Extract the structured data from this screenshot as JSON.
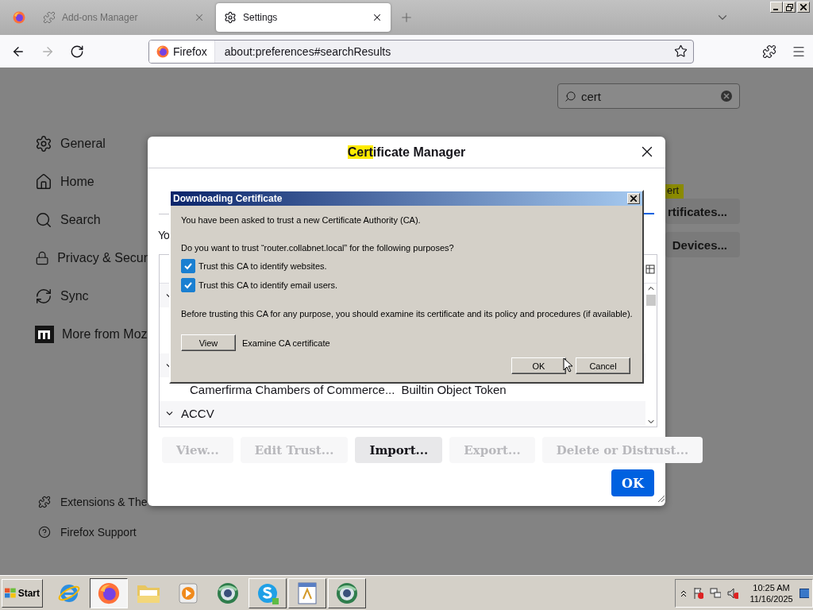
{
  "tab_strip": {
    "tabs": [
      {
        "label": "Add-ons Manager",
        "kind": "addons",
        "selected": false
      },
      {
        "label": "Settings",
        "kind": "settings",
        "selected": true
      }
    ]
  },
  "toolbar": {
    "buttons": [
      {
        "kind": "back",
        "disabled": false
      },
      {
        "kind": "forward",
        "disabled": true
      },
      {
        "kind": "reload",
        "disabled": false
      }
    ],
    "identity": "Firefox",
    "url": "about:preferences#searchResults"
  },
  "sidebar": {
    "items": [
      {
        "label": "General",
        "kind": "gear"
      },
      {
        "label": "Home",
        "kind": "home"
      },
      {
        "label": "Search",
        "kind": "search"
      },
      {
        "label": "Privacy & Secur",
        "kind": "lock"
      },
      {
        "label": "Sync",
        "kind": "sync"
      },
      {
        "label": "More from Moz",
        "kind": "mozilla"
      }
    ],
    "footer": [
      {
        "label": "Extensions & The",
        "kind": "puzzle"
      },
      {
        "label": "Firefox Support",
        "kind": "help"
      }
    ]
  },
  "search": {
    "value": "cert"
  },
  "results": [
    {
      "kind": "highlight",
      "text": "ert"
    },
    {
      "kind": "button",
      "text": "rtificates..."
    },
    {
      "kind": "button",
      "text": "Devices..."
    }
  ],
  "certificate_manager": {
    "title": [
      {
        "text": "Cert",
        "highlighted": true
      },
      {
        "text": "ificate Manager",
        "highlighted": false
      }
    ],
    "tab_fragment": "Yo",
    "rows": [
      {
        "kind": "group",
        "expanded": true
      },
      {
        "kind": "group",
        "expanded": true
      },
      {
        "kind": "cert",
        "name": "Camerfirma Chambers of Commerce...",
        "token": "Builtin Object Token"
      },
      {
        "kind": "group",
        "label": "ACCV",
        "expanded": true
      }
    ],
    "buttons": [
      {
        "label": "View...",
        "disabled": true
      },
      {
        "label": "Edit Trust...",
        "disabled": true
      },
      {
        "label": "Import...",
        "disabled": false
      },
      {
        "label": "Export...",
        "disabled": true
      },
      {
        "label": "Delete or Distrust...",
        "disabled": true
      }
    ],
    "ok_button": "OK"
  },
  "download_dialog": {
    "title": "Downloading Certificate",
    "intro": "You have been asked to trust a new Certificate Authority (CA).",
    "question": "Do you want to trust “router.collabnet.local” for the following purposes?",
    "options": [
      {
        "label": "Trust this CA to identify websites.",
        "checked": true
      },
      {
        "label": "Trust this CA to identify email users.",
        "checked": true
      }
    ],
    "advice": "Before trusting this CA for any purpose, you should examine its certificate and its policy and procedures (if available).",
    "view_button": "View",
    "view_caption": "Examine CA certificate",
    "buttons": [
      "OK",
      "Cancel"
    ]
  },
  "taskbar": {
    "start": "Start",
    "apps": [
      {
        "kind": "ie",
        "selected": false,
        "open": false
      },
      {
        "kind": "firefox",
        "selected": true,
        "open": true
      },
      {
        "kind": "folder",
        "selected": false,
        "open": false
      },
      {
        "kind": "media",
        "selected": false,
        "open": false
      },
      {
        "kind": "globe",
        "selected": false,
        "open": false
      },
      {
        "kind": "skype",
        "selected": false,
        "open": true
      },
      {
        "kind": "document",
        "selected": false,
        "open": true
      },
      {
        "kind": "globe",
        "selected": false,
        "open": true
      }
    ],
    "tray": {
      "time": "10:25 AM",
      "date": "11/16/2025"
    }
  }
}
